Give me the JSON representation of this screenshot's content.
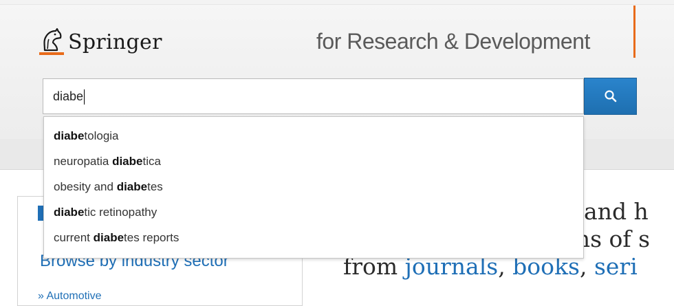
{
  "brand": {
    "name": "Springer",
    "tagline": "for Research & Development"
  },
  "search": {
    "query": "diabe",
    "button_icon": "search-icon",
    "suggestions": [
      {
        "before": "",
        "match": "diabe",
        "after": "tologia"
      },
      {
        "before": "neuropatia ",
        "match": "diabe",
        "after": "tica"
      },
      {
        "before": "obesity and ",
        "match": "diabe",
        "after": "tes"
      },
      {
        "before": "",
        "match": "diabe",
        "after": "tic retinopathy"
      },
      {
        "before": "current ",
        "match": "diabe",
        "after": "tes reports"
      }
    ]
  },
  "sidebar": {
    "browse_heading": "Browse by industry sector",
    "first_item": "» Automotive"
  },
  "hero": {
    "line1": "e and h",
    "line2": "ons of s",
    "line3_start": "from ",
    "line3_link1": "journals",
    "line3_sep1": ", ",
    "line3_link2": "books",
    "line3_sep2": ", ",
    "line3_link3": "seri"
  },
  "colors": {
    "accent_orange": "#e86b1a",
    "link_blue": "#1f6fb6",
    "button_blue": "#2a84cc"
  }
}
